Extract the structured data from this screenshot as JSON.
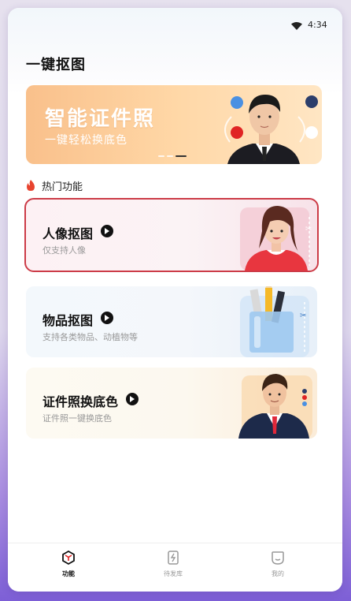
{
  "status_bar": {
    "time": "4:34"
  },
  "page": {
    "title": "一键抠图"
  },
  "banner": {
    "title": "智能证件照",
    "subtitle": "一键轻松换底色",
    "colors": {
      "blue": "#4a90e2",
      "navy": "#2c3e6b",
      "red": "#e02424",
      "white": "#ffffff"
    }
  },
  "section": {
    "title": "热门功能"
  },
  "cards": [
    {
      "title": "人像抠图",
      "subtitle": "仅支持人像",
      "accent": "#cc3b47"
    },
    {
      "title": "物品抠图",
      "subtitle": "支持各类物品、动植物等"
    },
    {
      "title": "证件照换底色",
      "subtitle": "证件照一键换底色"
    }
  ],
  "tabs": [
    {
      "label": "功能",
      "icon": "cube-icon",
      "active": true
    },
    {
      "label": "待发库",
      "icon": "document-icon",
      "active": false
    },
    {
      "label": "我的",
      "icon": "face-icon",
      "active": false
    }
  ]
}
